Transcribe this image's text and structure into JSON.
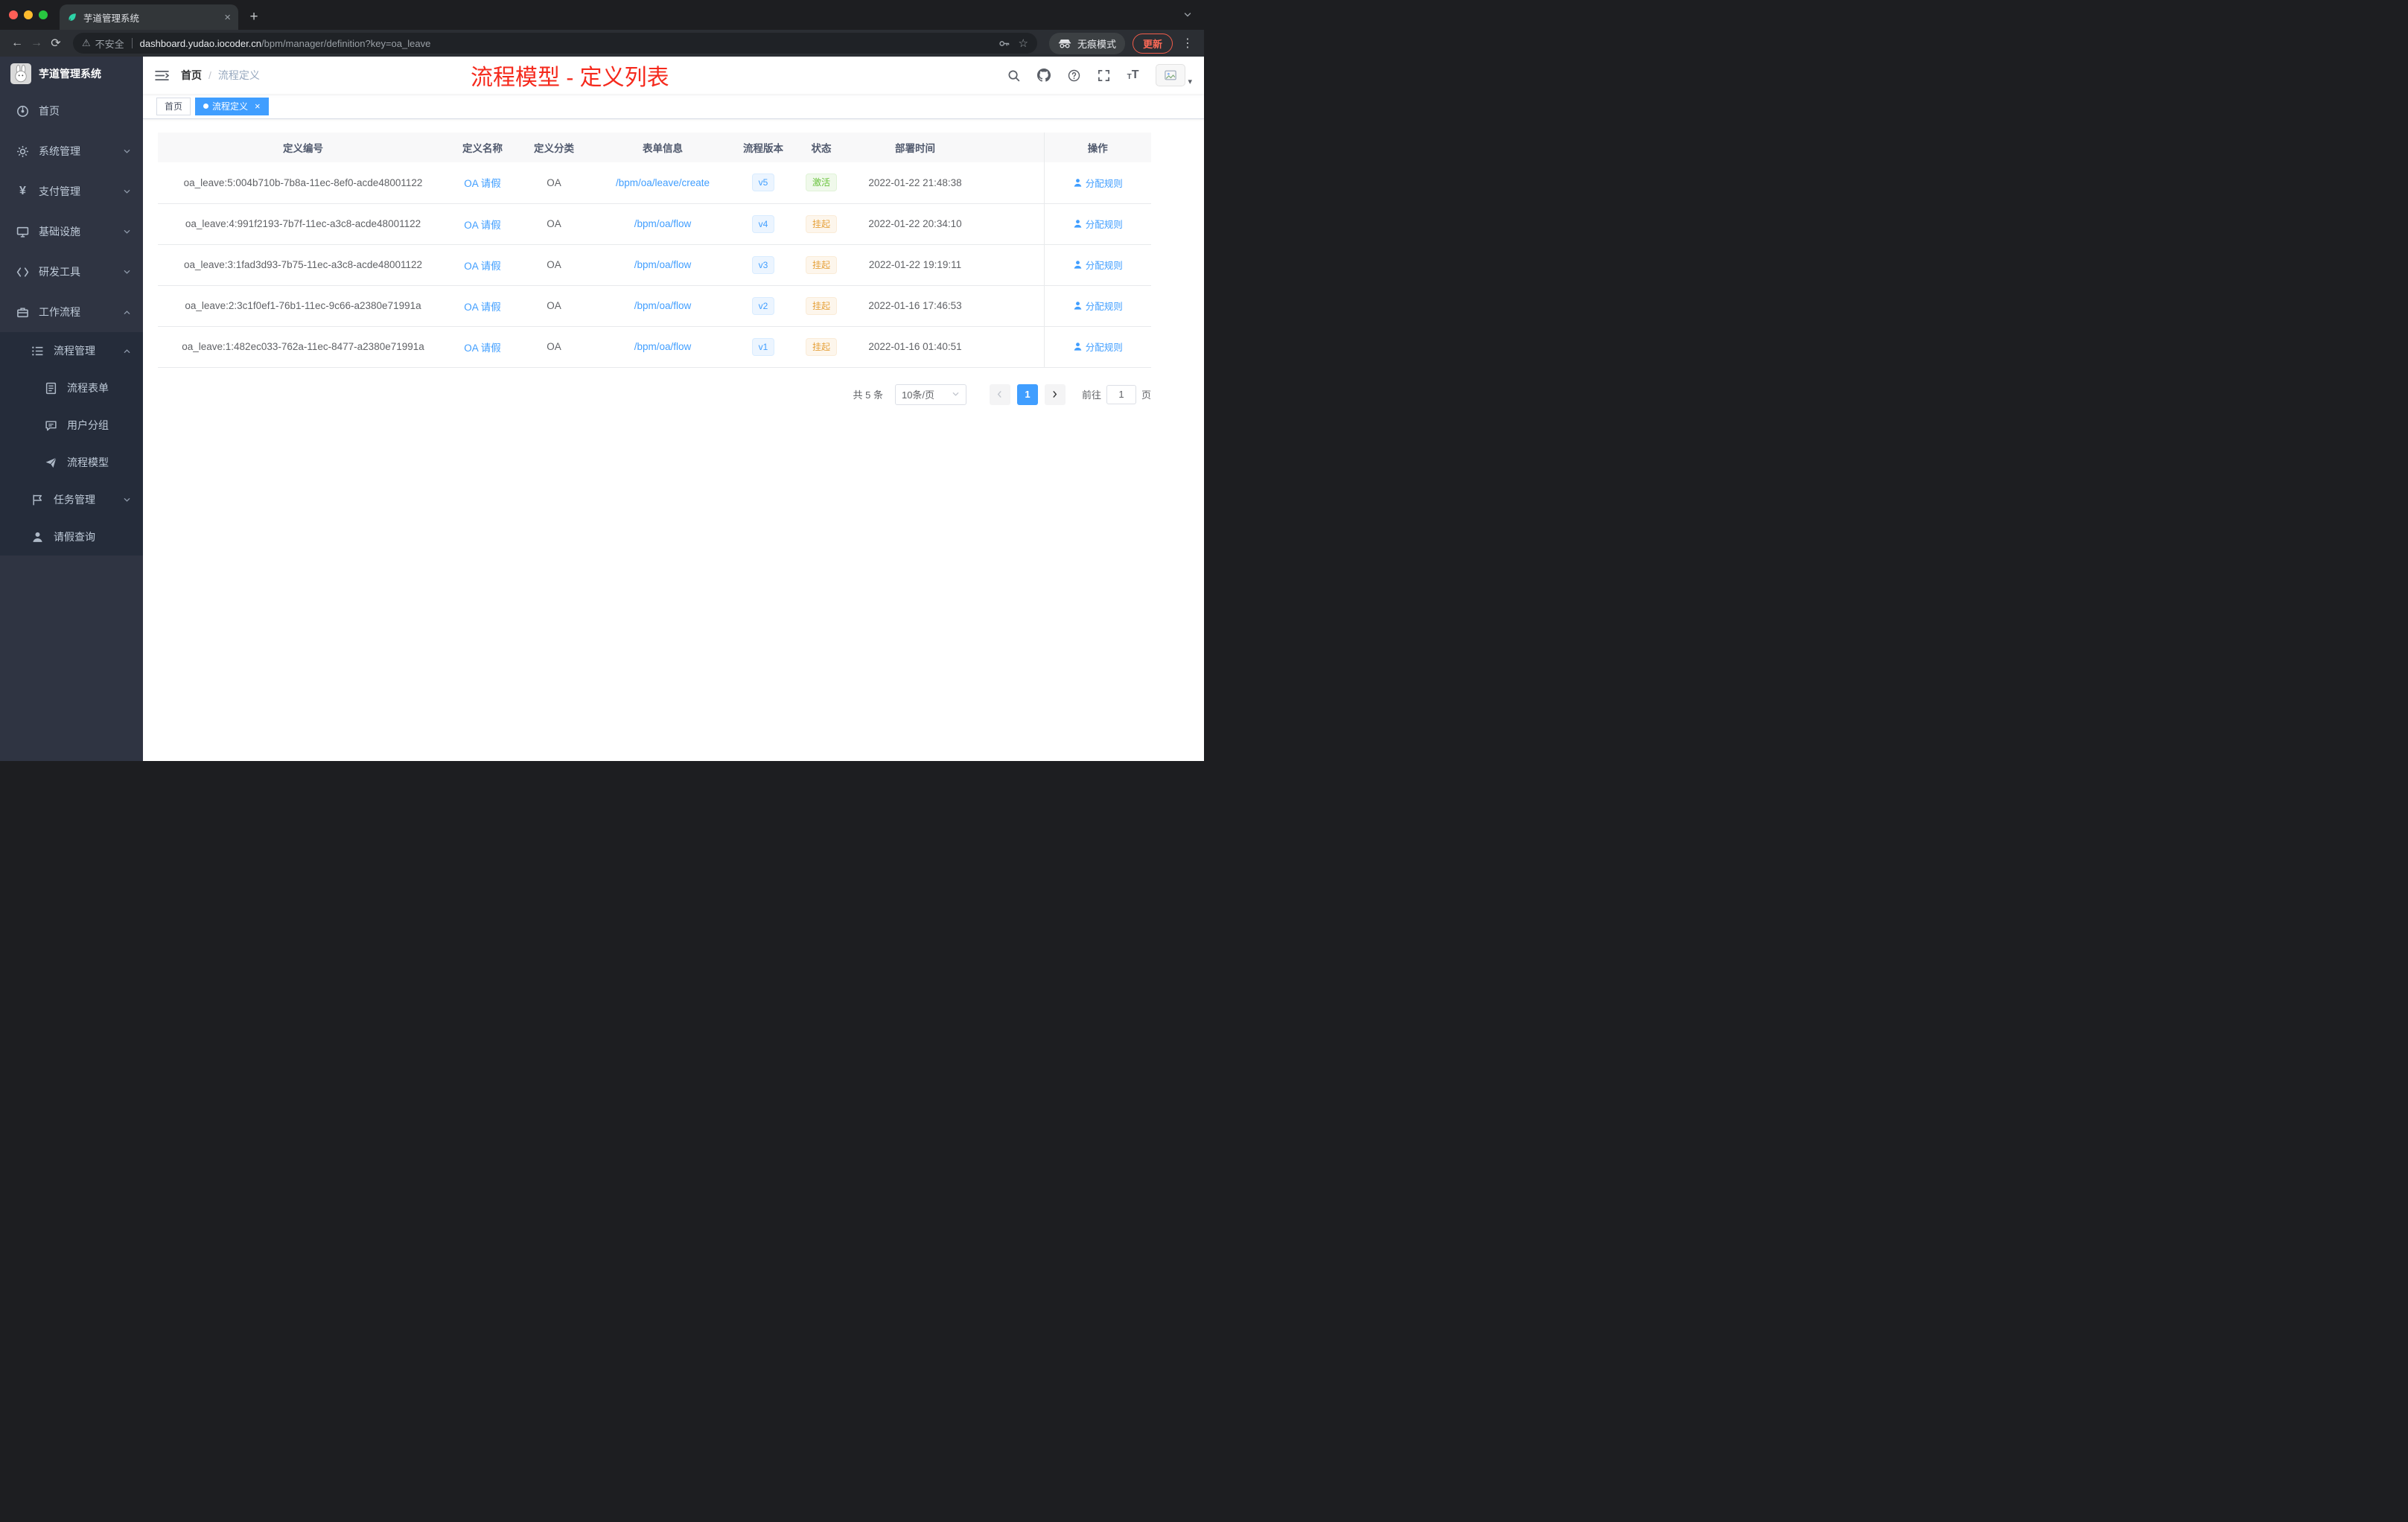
{
  "colors": {
    "accent": "#409eff",
    "success_text": "#67c23a",
    "warning_text": "#e6a23c",
    "annotation_red": "#f5291c",
    "sidebar_bg": "#2f3442"
  },
  "browser": {
    "tab_title": "芋道管理系统",
    "new_tab_label": "+",
    "security_label": "不安全",
    "url_host": "dashboard.yudao.iocoder.cn",
    "url_path": "/bpm/manager/definition?key=oa_leave",
    "incognito_label": "无痕模式",
    "update_label": "更新"
  },
  "sidebar": {
    "logo_title": "芋道管理系统",
    "items": [
      {
        "label": "首页"
      },
      {
        "label": "系统管理"
      },
      {
        "label": "支付管理"
      },
      {
        "label": "基础设施"
      },
      {
        "label": "研发工具"
      },
      {
        "label": "工作流程"
      }
    ],
    "workflow_children": {
      "process_mgmt": "流程管理",
      "process_form": "流程表单",
      "user_group": "用户分组",
      "process_model": "流程模型",
      "task_mgmt": "任务管理",
      "leave_query": "请假查询"
    }
  },
  "header": {
    "breadcrumb_home": "首页",
    "breadcrumb_sep": "/",
    "breadcrumb_current": "流程定义",
    "annotation": "流程模型 - 定义列表"
  },
  "tags": {
    "home": "首页",
    "current": "流程定义",
    "close": "×"
  },
  "table": {
    "columns": [
      "定义编号",
      "定义名称",
      "定义分类",
      "表单信息",
      "流程版本",
      "状态",
      "部署时间",
      "操作"
    ],
    "rows": [
      {
        "id": "oa_leave:5:004b710b-7b8a-11ec-8ef0-acde48001122",
        "name": "OA 请假",
        "category": "OA",
        "form": "/bpm/oa/leave/create",
        "version": "v5",
        "status": "激活",
        "status_type": "success",
        "time": "2022-01-22 21:48:38",
        "action": "分配规则"
      },
      {
        "id": "oa_leave:4:991f2193-7b7f-11ec-a3c8-acde48001122",
        "name": "OA 请假",
        "category": "OA",
        "form": "/bpm/oa/flow",
        "version": "v4",
        "status": "挂起",
        "status_type": "warning",
        "time": "2022-01-22 20:34:10",
        "action": "分配规则"
      },
      {
        "id": "oa_leave:3:1fad3d93-7b75-11ec-a3c8-acde48001122",
        "name": "OA 请假",
        "category": "OA",
        "form": "/bpm/oa/flow",
        "version": "v3",
        "status": "挂起",
        "status_type": "warning",
        "time": "2022-01-22 19:19:11",
        "action": "分配规则"
      },
      {
        "id": "oa_leave:2:3c1f0ef1-76b1-11ec-9c66-a2380e71991a",
        "name": "OA 请假",
        "category": "OA",
        "form": "/bpm/oa/flow",
        "version": "v2",
        "status": "挂起",
        "status_type": "warning",
        "time": "2022-01-16 17:46:53",
        "action": "分配规则"
      },
      {
        "id": "oa_leave:1:482ec033-762a-11ec-8477-a2380e71991a",
        "name": "OA 请假",
        "category": "OA",
        "form": "/bpm/oa/flow",
        "version": "v1",
        "status": "挂起",
        "status_type": "warning",
        "time": "2022-01-16 01:40:51",
        "action": "分配规则"
      }
    ]
  },
  "pagination": {
    "total": "共 5 条",
    "page_size": "10条/页",
    "current_page": "1",
    "goto_label": "前往",
    "goto_value": "1",
    "page_unit": "页"
  }
}
